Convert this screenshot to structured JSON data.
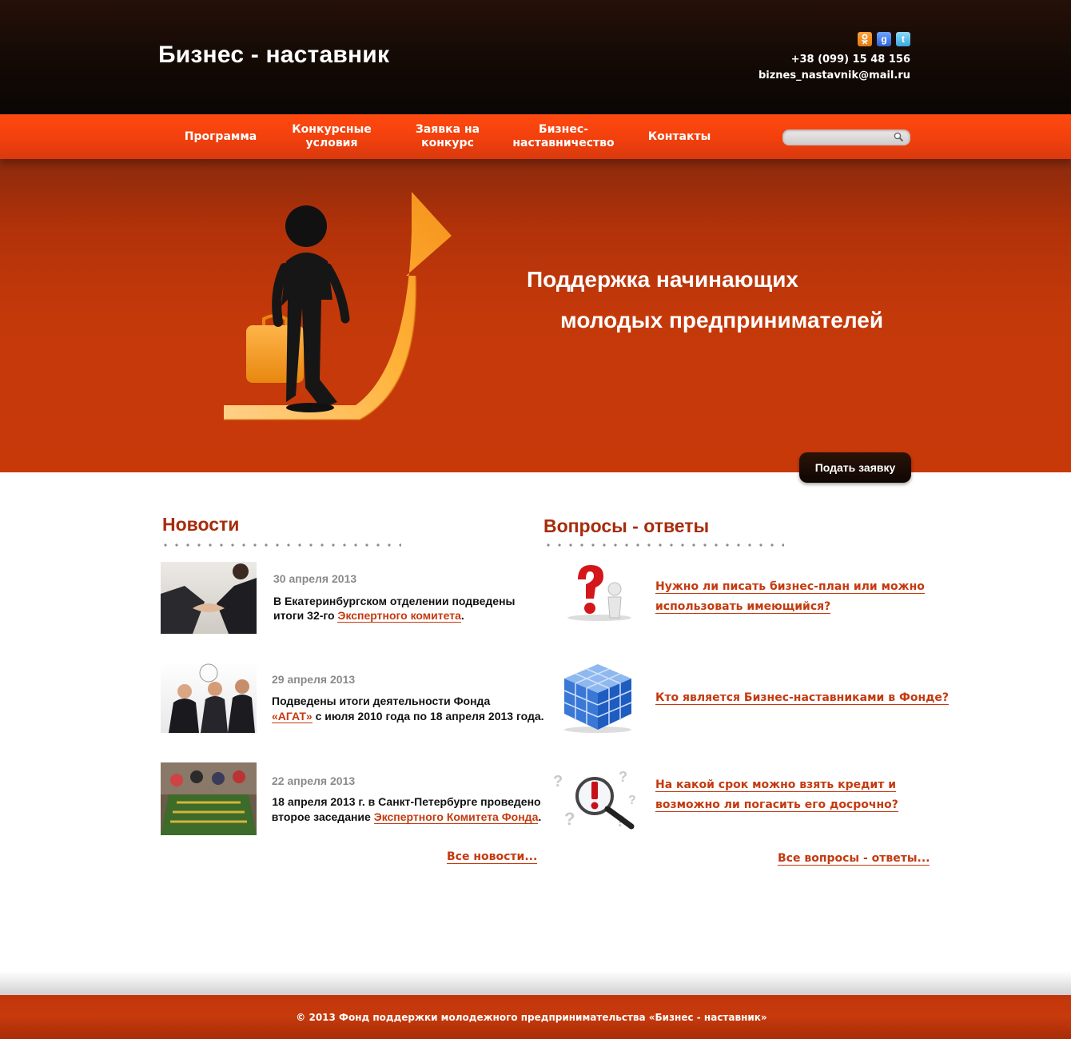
{
  "header": {
    "title": "Бизнес - наставник",
    "phone": "+38 (099) 15 48 156",
    "email": "biznes_nastavnik@mail.ru",
    "social": [
      {
        "name": "odnoklassniki",
        "glyph": "ok"
      },
      {
        "name": "google",
        "glyph": "g"
      },
      {
        "name": "twitter",
        "glyph": "t"
      }
    ]
  },
  "nav": {
    "items": [
      {
        "label": "Программа"
      },
      {
        "label": "Конкурсные условия"
      },
      {
        "label": "Заявка на конкурс"
      },
      {
        "label": "Бизнес-наставничество"
      },
      {
        "label": "Контакты"
      }
    ],
    "search_placeholder": ""
  },
  "banner": {
    "line1": "Поддержка начинающих",
    "line2": "молодых предпринимателей",
    "apply_button": "Подать заявку"
  },
  "news": {
    "title": "Новости",
    "items": [
      {
        "date": "30 апреля 2013",
        "text": "В Екатеринбургском отделении подведены итоги 32-го",
        "link": "Экспертного комитета",
        "after": "."
      },
      {
        "date": "29 апреля 2013",
        "text": "Подведены итоги деятельности Фонда",
        "link": "«АГАТ»",
        "after": " с июля 2010 года по 18 апреля 2013 года."
      },
      {
        "date": "22 апреля 2013",
        "text": "18 апреля 2013 г. в Санкт-Петербурге проведено второе заседание",
        "link": "Экспертного Комитета Фонда",
        "after": "."
      }
    ],
    "all_link": "Все новости..."
  },
  "faq": {
    "title": "Вопросы - ответы",
    "items": [
      {
        "question_l1": "Нужно ли писать бизнес-план или можно",
        "question_l2": "использовать имеющийся?"
      },
      {
        "question_l1": "Кто является Бизнес-наставниками в Фонде?",
        "question_l2": ""
      },
      {
        "question_l1": "На какой срок можно взять кредит и",
        "question_l2": "возможно ли погасить его досрочно?"
      }
    ],
    "all_link": "Все вопросы - ответы..."
  },
  "footer": {
    "copyright": "© 2013 Фонд поддержки молодежного предпринимательства «Бизнес - наставник»"
  },
  "colors": {
    "accent": "#f2400d",
    "link": "#c43a10",
    "heading": "#a62c0c",
    "header_bg": "#120905"
  }
}
